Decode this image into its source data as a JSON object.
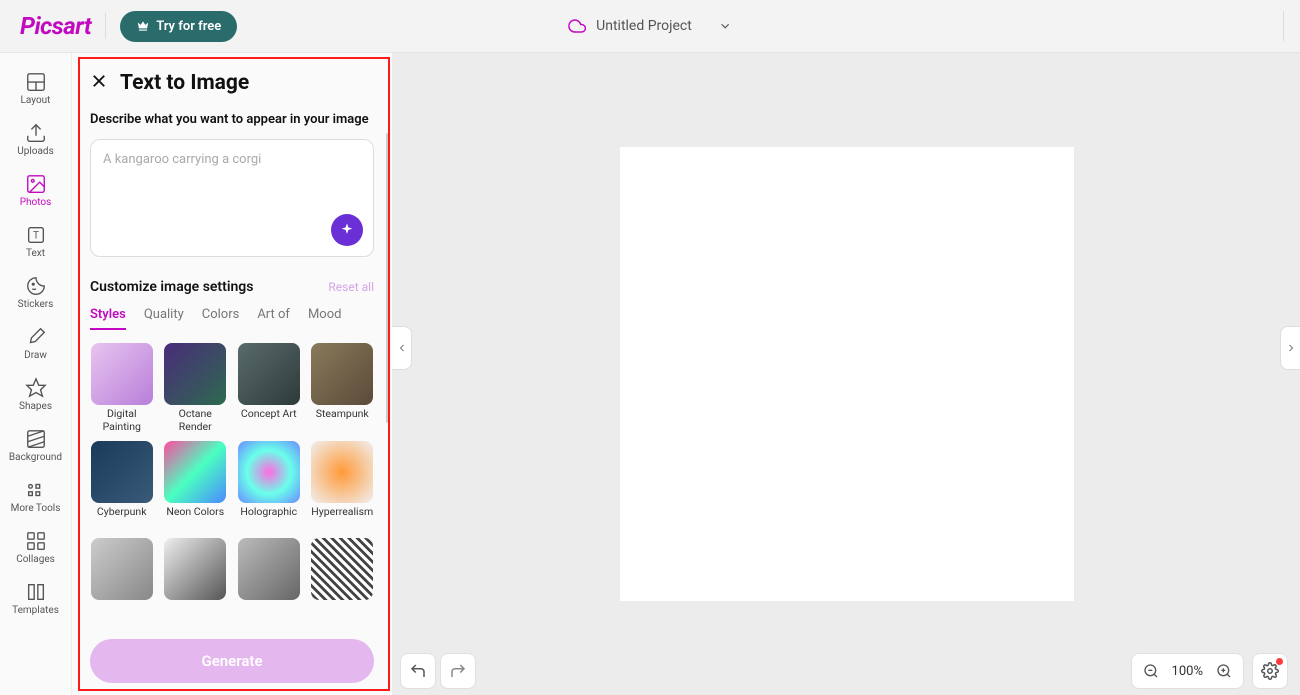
{
  "header": {
    "logo": "Picsart",
    "try_label": "Try for free",
    "project_name": "Untitled Project"
  },
  "rail": {
    "items": [
      {
        "key": "layout",
        "label": "Layout"
      },
      {
        "key": "uploads",
        "label": "Uploads"
      },
      {
        "key": "photos",
        "label": "Photos"
      },
      {
        "key": "text",
        "label": "Text"
      },
      {
        "key": "stickers",
        "label": "Stickers"
      },
      {
        "key": "draw",
        "label": "Draw"
      },
      {
        "key": "shapes",
        "label": "Shapes"
      },
      {
        "key": "background",
        "label": "Background"
      },
      {
        "key": "moretools",
        "label": "More Tools"
      },
      {
        "key": "collages",
        "label": "Collages"
      },
      {
        "key": "templates",
        "label": "Templates"
      }
    ],
    "active": "photos"
  },
  "panel": {
    "title": "Text to Image",
    "describe_label": "Describe what you want to appear in your image",
    "prompt_value": "",
    "prompt_placeholder": "A kangaroo carrying a corgi",
    "customize_label": "Customize image settings",
    "reset_label": "Reset all",
    "tabs": [
      {
        "key": "styles",
        "label": "Styles"
      },
      {
        "key": "quality",
        "label": "Quality"
      },
      {
        "key": "colors",
        "label": "Colors"
      },
      {
        "key": "artof",
        "label": "Art of"
      },
      {
        "key": "mood",
        "label": "Mood"
      }
    ],
    "active_tab": "styles",
    "styles": [
      {
        "label": "Digital Painting"
      },
      {
        "label": "Octane Render"
      },
      {
        "label": "Concept Art"
      },
      {
        "label": "Steampunk"
      },
      {
        "label": "Cyberpunk"
      },
      {
        "label": "Neon Colors"
      },
      {
        "label": "Holographic"
      },
      {
        "label": "Hyperrealism"
      },
      {
        "label": ""
      },
      {
        "label": ""
      },
      {
        "label": ""
      },
      {
        "label": ""
      }
    ],
    "generate_label": "Generate"
  },
  "canvas": {
    "zoom": "100%"
  },
  "colors": {
    "accent": "#c209c1",
    "highlight_border": "#ff1a1a",
    "generate_bg": "#e4b8ee",
    "sparkle_bg": "#6b2fd6"
  }
}
